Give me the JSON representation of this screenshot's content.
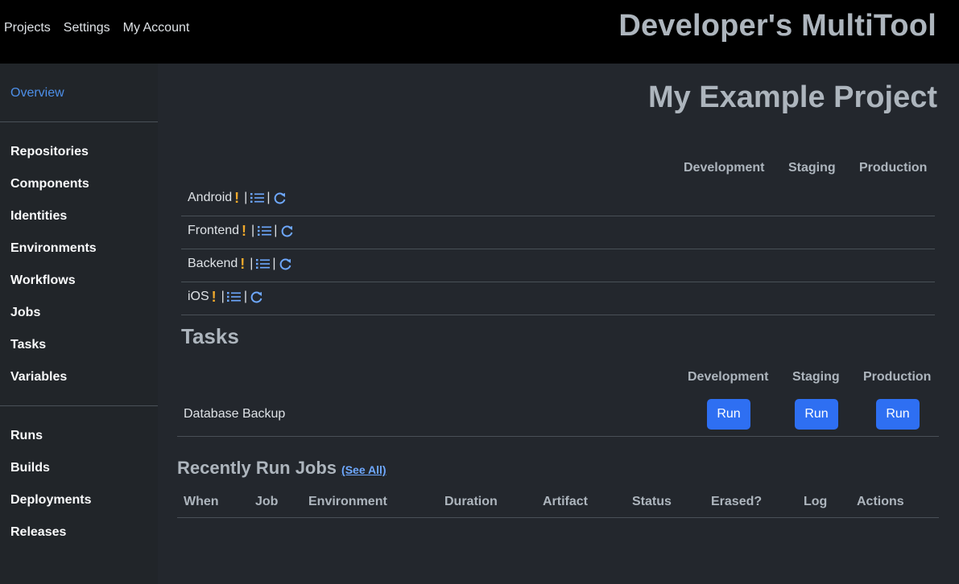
{
  "topbar": {
    "nav": [
      "Projects",
      "Settings",
      "My Account"
    ],
    "brand": "Developer's MultiTool"
  },
  "sidebar": {
    "active": "Overview",
    "group1": [
      "Repositories",
      "Components",
      "Identities",
      "Environments",
      "Workflows",
      "Jobs",
      "Tasks",
      "Variables"
    ],
    "group2": [
      "Runs",
      "Builds",
      "Deployments",
      "Releases"
    ]
  },
  "project": {
    "title": "My Example Project"
  },
  "components": {
    "environments": [
      "Development",
      "Staging",
      "Production"
    ],
    "rows": [
      {
        "name": "Android",
        "warn": "!"
      },
      {
        "name": "Frontend",
        "warn": "!"
      },
      {
        "name": "Backend",
        "warn": "!"
      },
      {
        "name": "iOS",
        "warn": "!"
      }
    ],
    "separator": "|",
    "icons": [
      "list-icon",
      "refresh-icon"
    ]
  },
  "tasks": {
    "title": "Tasks",
    "environments": [
      "Development",
      "Staging",
      "Production"
    ],
    "rows": [
      {
        "name": "Database Backup",
        "run_label": "Run"
      }
    ]
  },
  "jobs": {
    "title": "Recently Run Jobs",
    "see_all": "(See All)",
    "columns": [
      "When",
      "Job",
      "Environment",
      "Duration",
      "Artifact",
      "Status",
      "Erased?",
      "Log",
      "Actions"
    ]
  },
  "colors": {
    "accent": "#2e6ff2",
    "link": "#6ea8fe",
    "warning": "#f0a92c",
    "active_nav": "#4d8fe8"
  }
}
